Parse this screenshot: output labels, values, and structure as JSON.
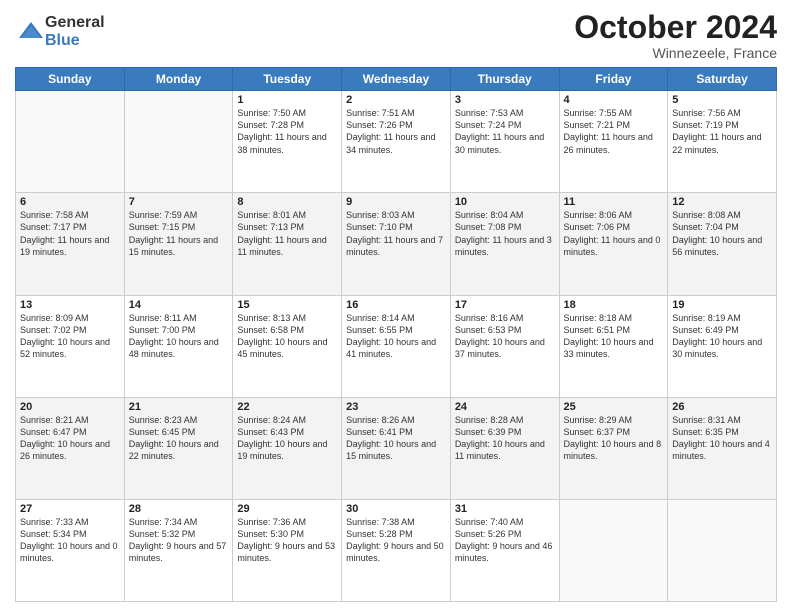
{
  "header": {
    "logo": {
      "general": "General",
      "blue": "Blue"
    },
    "title": "October 2024",
    "location": "Winnezeele, France"
  },
  "weekdays": [
    "Sunday",
    "Monday",
    "Tuesday",
    "Wednesday",
    "Thursday",
    "Friday",
    "Saturday"
  ],
  "weeks": [
    [
      {
        "day": null,
        "sunrise": null,
        "sunset": null,
        "daylight": null
      },
      {
        "day": null,
        "sunrise": null,
        "sunset": null,
        "daylight": null
      },
      {
        "day": "1",
        "sunrise": "7:50 AM",
        "sunset": "7:28 PM",
        "daylight": "11 hours and 38 minutes."
      },
      {
        "day": "2",
        "sunrise": "7:51 AM",
        "sunset": "7:26 PM",
        "daylight": "11 hours and 34 minutes."
      },
      {
        "day": "3",
        "sunrise": "7:53 AM",
        "sunset": "7:24 PM",
        "daylight": "11 hours and 30 minutes."
      },
      {
        "day": "4",
        "sunrise": "7:55 AM",
        "sunset": "7:21 PM",
        "daylight": "11 hours and 26 minutes."
      },
      {
        "day": "5",
        "sunrise": "7:56 AM",
        "sunset": "7:19 PM",
        "daylight": "11 hours and 22 minutes."
      }
    ],
    [
      {
        "day": "6",
        "sunrise": "7:58 AM",
        "sunset": "7:17 PM",
        "daylight": "11 hours and 19 minutes."
      },
      {
        "day": "7",
        "sunrise": "7:59 AM",
        "sunset": "7:15 PM",
        "daylight": "11 hours and 15 minutes."
      },
      {
        "day": "8",
        "sunrise": "8:01 AM",
        "sunset": "7:13 PM",
        "daylight": "11 hours and 11 minutes."
      },
      {
        "day": "9",
        "sunrise": "8:03 AM",
        "sunset": "7:10 PM",
        "daylight": "11 hours and 7 minutes."
      },
      {
        "day": "10",
        "sunrise": "8:04 AM",
        "sunset": "7:08 PM",
        "daylight": "11 hours and 3 minutes."
      },
      {
        "day": "11",
        "sunrise": "8:06 AM",
        "sunset": "7:06 PM",
        "daylight": "11 hours and 0 minutes."
      },
      {
        "day": "12",
        "sunrise": "8:08 AM",
        "sunset": "7:04 PM",
        "daylight": "10 hours and 56 minutes."
      }
    ],
    [
      {
        "day": "13",
        "sunrise": "8:09 AM",
        "sunset": "7:02 PM",
        "daylight": "10 hours and 52 minutes."
      },
      {
        "day": "14",
        "sunrise": "8:11 AM",
        "sunset": "7:00 PM",
        "daylight": "10 hours and 48 minutes."
      },
      {
        "day": "15",
        "sunrise": "8:13 AM",
        "sunset": "6:58 PM",
        "daylight": "10 hours and 45 minutes."
      },
      {
        "day": "16",
        "sunrise": "8:14 AM",
        "sunset": "6:55 PM",
        "daylight": "10 hours and 41 minutes."
      },
      {
        "day": "17",
        "sunrise": "8:16 AM",
        "sunset": "6:53 PM",
        "daylight": "10 hours and 37 minutes."
      },
      {
        "day": "18",
        "sunrise": "8:18 AM",
        "sunset": "6:51 PM",
        "daylight": "10 hours and 33 minutes."
      },
      {
        "day": "19",
        "sunrise": "8:19 AM",
        "sunset": "6:49 PM",
        "daylight": "10 hours and 30 minutes."
      }
    ],
    [
      {
        "day": "20",
        "sunrise": "8:21 AM",
        "sunset": "6:47 PM",
        "daylight": "10 hours and 26 minutes."
      },
      {
        "day": "21",
        "sunrise": "8:23 AM",
        "sunset": "6:45 PM",
        "daylight": "10 hours and 22 minutes."
      },
      {
        "day": "22",
        "sunrise": "8:24 AM",
        "sunset": "6:43 PM",
        "daylight": "10 hours and 19 minutes."
      },
      {
        "day": "23",
        "sunrise": "8:26 AM",
        "sunset": "6:41 PM",
        "daylight": "10 hours and 15 minutes."
      },
      {
        "day": "24",
        "sunrise": "8:28 AM",
        "sunset": "6:39 PM",
        "daylight": "10 hours and 11 minutes."
      },
      {
        "day": "25",
        "sunrise": "8:29 AM",
        "sunset": "6:37 PM",
        "daylight": "10 hours and 8 minutes."
      },
      {
        "day": "26",
        "sunrise": "8:31 AM",
        "sunset": "6:35 PM",
        "daylight": "10 hours and 4 minutes."
      }
    ],
    [
      {
        "day": "27",
        "sunrise": "7:33 AM",
        "sunset": "5:34 PM",
        "daylight": "10 hours and 0 minutes."
      },
      {
        "day": "28",
        "sunrise": "7:34 AM",
        "sunset": "5:32 PM",
        "daylight": "9 hours and 57 minutes."
      },
      {
        "day": "29",
        "sunrise": "7:36 AM",
        "sunset": "5:30 PM",
        "daylight": "9 hours and 53 minutes."
      },
      {
        "day": "30",
        "sunrise": "7:38 AM",
        "sunset": "5:28 PM",
        "daylight": "9 hours and 50 minutes."
      },
      {
        "day": "31",
        "sunrise": "7:40 AM",
        "sunset": "5:26 PM",
        "daylight": "9 hours and 46 minutes."
      },
      {
        "day": null,
        "sunrise": null,
        "sunset": null,
        "daylight": null
      },
      {
        "day": null,
        "sunrise": null,
        "sunset": null,
        "daylight": null
      }
    ]
  ],
  "labels": {
    "sunrise_prefix": "Sunrise: ",
    "sunset_prefix": "Sunset: ",
    "daylight_prefix": "Daylight: "
  }
}
